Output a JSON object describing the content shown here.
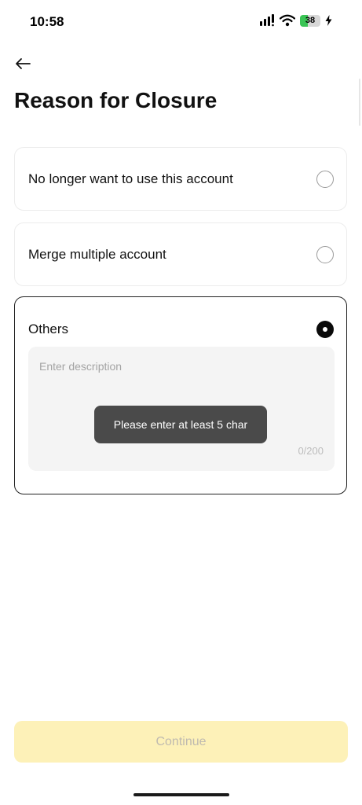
{
  "status_bar": {
    "time": "10:58",
    "battery_level": "38",
    "battery_percent": 38,
    "icons": [
      "signal-icon",
      "wifi-icon",
      "battery-icon",
      "charging-bolt-icon"
    ]
  },
  "header": {
    "back_icon": "arrow-left-icon",
    "title": "Reason for Closure"
  },
  "options": [
    {
      "label": "No longer want to use this account",
      "selected": false
    },
    {
      "label": "Merge multiple account",
      "selected": false
    },
    {
      "label": "Others",
      "selected": true
    }
  ],
  "description": {
    "placeholder": "Enter description",
    "counter": "0/200"
  },
  "toast": {
    "message": "Please enter at least 5 char"
  },
  "footer": {
    "continue_label": "Continue"
  },
  "colors": {
    "accent_disabled_bg": "#fdf1b8",
    "toast_bg": "#4a4a4a",
    "battery_green": "#3ac455",
    "selected_border": "#222222"
  }
}
